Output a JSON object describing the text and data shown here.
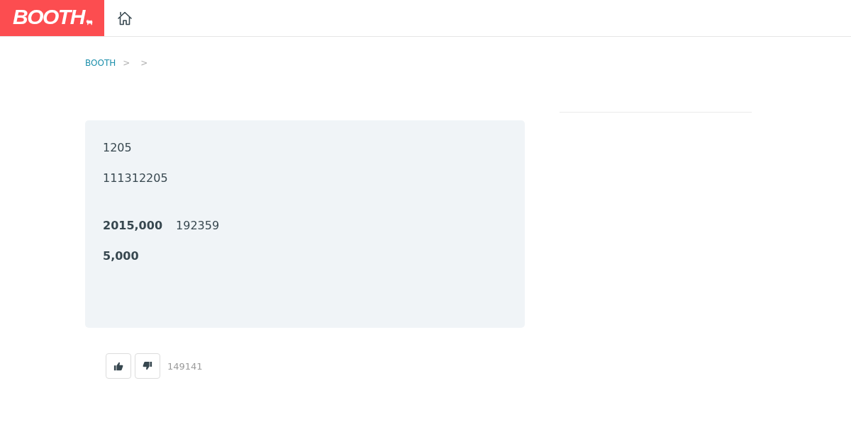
{
  "header": {
    "logo": "BOOTH"
  },
  "breadcrumb": [
    {
      "kind": "link",
      "text": "BOOTH"
    },
    {
      "kind": "separator",
      "text": ">"
    },
    {
      "kind": "separator",
      "text": ">"
    }
  ],
  "card": {
    "description": [
      "1205",
      "111312205"
    ],
    "prices": [
      {
        "amount": "2015,000",
        "note": "192359"
      },
      {
        "amount": "5,000"
      }
    ]
  },
  "votes": {
    "buttons": [
      {
        "kind": "up"
      },
      {
        "kind": "down"
      }
    ],
    "count": "149141"
  }
}
